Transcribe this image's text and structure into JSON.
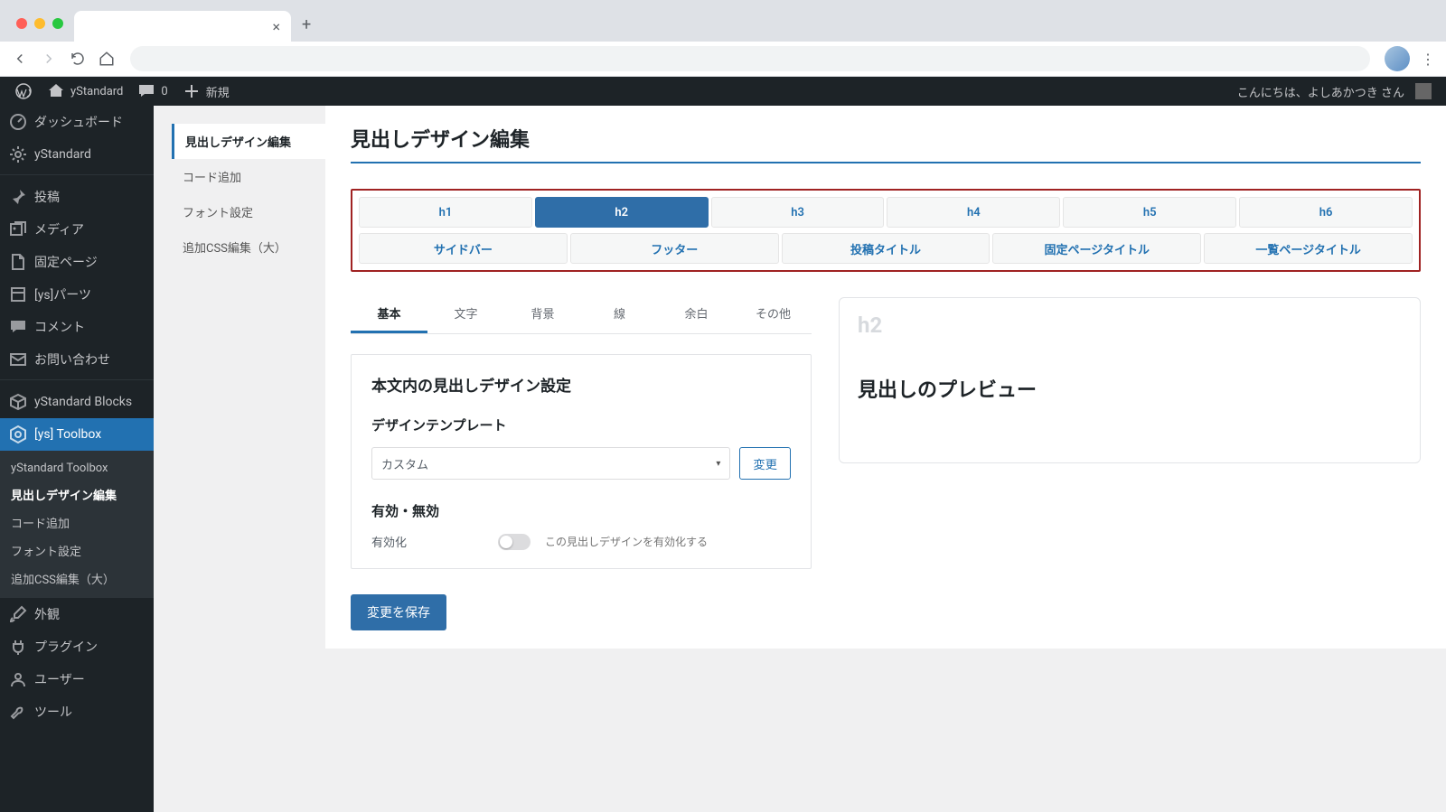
{
  "adminbar": {
    "site_name": "yStandard",
    "comments_count": "0",
    "new_label": "新規",
    "greeting": "こんにちは、よしあかつき さん"
  },
  "sidebar": {
    "items": [
      {
        "label": "ダッシュボード",
        "icon": "dashboard"
      },
      {
        "label": "yStandard",
        "icon": "settings"
      },
      {
        "label": "投稿",
        "icon": "pin"
      },
      {
        "label": "メディア",
        "icon": "media"
      },
      {
        "label": "固定ページ",
        "icon": "page"
      },
      {
        "label": "[ys]パーツ",
        "icon": "box"
      },
      {
        "label": "コメント",
        "icon": "comment"
      },
      {
        "label": "お問い合わせ",
        "icon": "mail"
      },
      {
        "label": "yStandard Blocks",
        "icon": "cube"
      },
      {
        "label": "[ys] Toolbox",
        "icon": "hexagon"
      },
      {
        "label": "外観",
        "icon": "brush"
      },
      {
        "label": "プラグイン",
        "icon": "plug"
      },
      {
        "label": "ユーザー",
        "icon": "user"
      },
      {
        "label": "ツール",
        "icon": "wrench"
      }
    ],
    "submenu": [
      "yStandard Toolbox",
      "見出しデザイン編集",
      "コード追加",
      "フォント設定",
      "追加CSS編集（大）"
    ]
  },
  "subnav": [
    "見出しデザイン編集",
    "コード追加",
    "フォント設定",
    "追加CSS編集（大）"
  ],
  "page": {
    "title": "見出しデザイン編集",
    "selector": {
      "row1": [
        "h1",
        "h2",
        "h3",
        "h4",
        "h5",
        "h6"
      ],
      "row2": [
        "サイドバー",
        "フッター",
        "投稿タイトル",
        "固定ページタイトル",
        "一覧ページタイトル"
      ]
    },
    "inner_tabs": [
      "基本",
      "文字",
      "背景",
      "線",
      "余白",
      "その他"
    ],
    "settings": {
      "card_title": "本文内の見出しデザイン設定",
      "template_heading": "デザインテンプレート",
      "template_selected": "カスタム",
      "change_btn": "変更",
      "enable_heading": "有効・無効",
      "enable_label": "有効化",
      "enable_desc": "この見出しデザインを有効化する"
    },
    "save_btn": "変更を保存",
    "preview": {
      "tag": "h2",
      "text": "見出しのプレビュー"
    }
  }
}
